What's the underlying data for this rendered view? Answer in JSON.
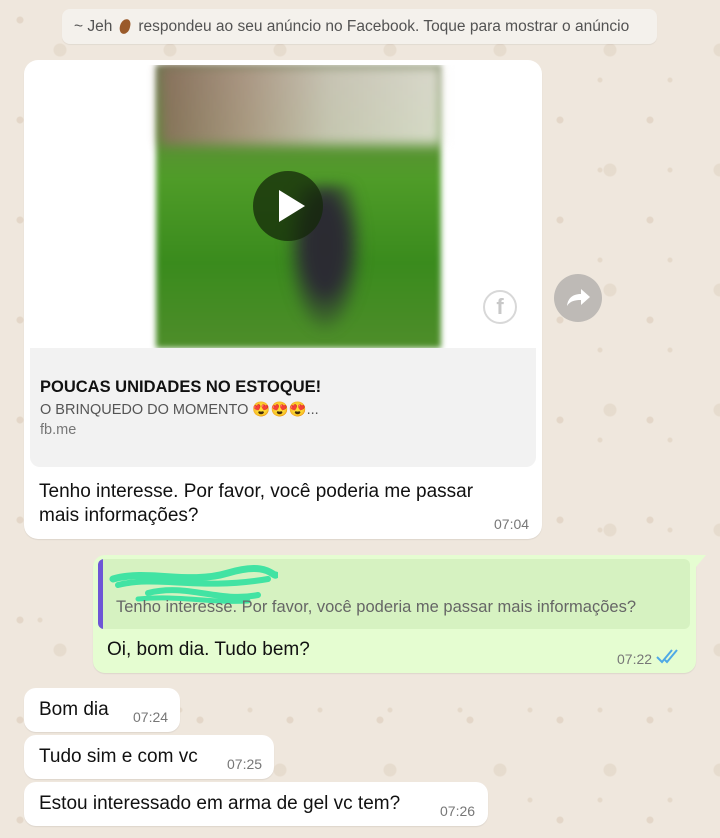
{
  "system_notice": {
    "prefix": "~ Jeh",
    "rest": "respondeu ao seu anúncio no Facebook. Toque para mostrar o anúncio",
    "emoji_icon": "ear-icon"
  },
  "ad_card": {
    "title": "POUCAS UNIDADES NO ESTOQUE!",
    "subtitle": "O BRINQUEDO DO MOMENTO 😍😍😍...",
    "link": "fb.me",
    "message": "Tenho interesse. Por favor, você poderia me passar mais informações?",
    "time": "07:04",
    "play_icon": "play-icon",
    "brand_icon": "facebook-icon"
  },
  "forward_icon": "forward-icon",
  "reply": {
    "quoted_sender_hidden": true,
    "quoted_text_visible": "Tenho interesse. Por favor, você poderia me passar mais informações?",
    "text": "Oi, bom dia. Tudo bem?",
    "time": "07:22",
    "status_icon": "double-check-read-icon",
    "status_color": "#4fa9e6"
  },
  "messages": [
    {
      "text": "Bom dia",
      "time": "07:24"
    },
    {
      "text": "Tudo sim e com vc",
      "time": "07:25"
    },
    {
      "text": "Estou interessado em arma de gel vc tem?",
      "time": "07:26"
    }
  ],
  "colors": {
    "background": "#efe7dd",
    "incoming_bubble": "#ffffff",
    "outgoing_bubble": "#e5fdd1",
    "quote_bar": "#6d56d6"
  }
}
